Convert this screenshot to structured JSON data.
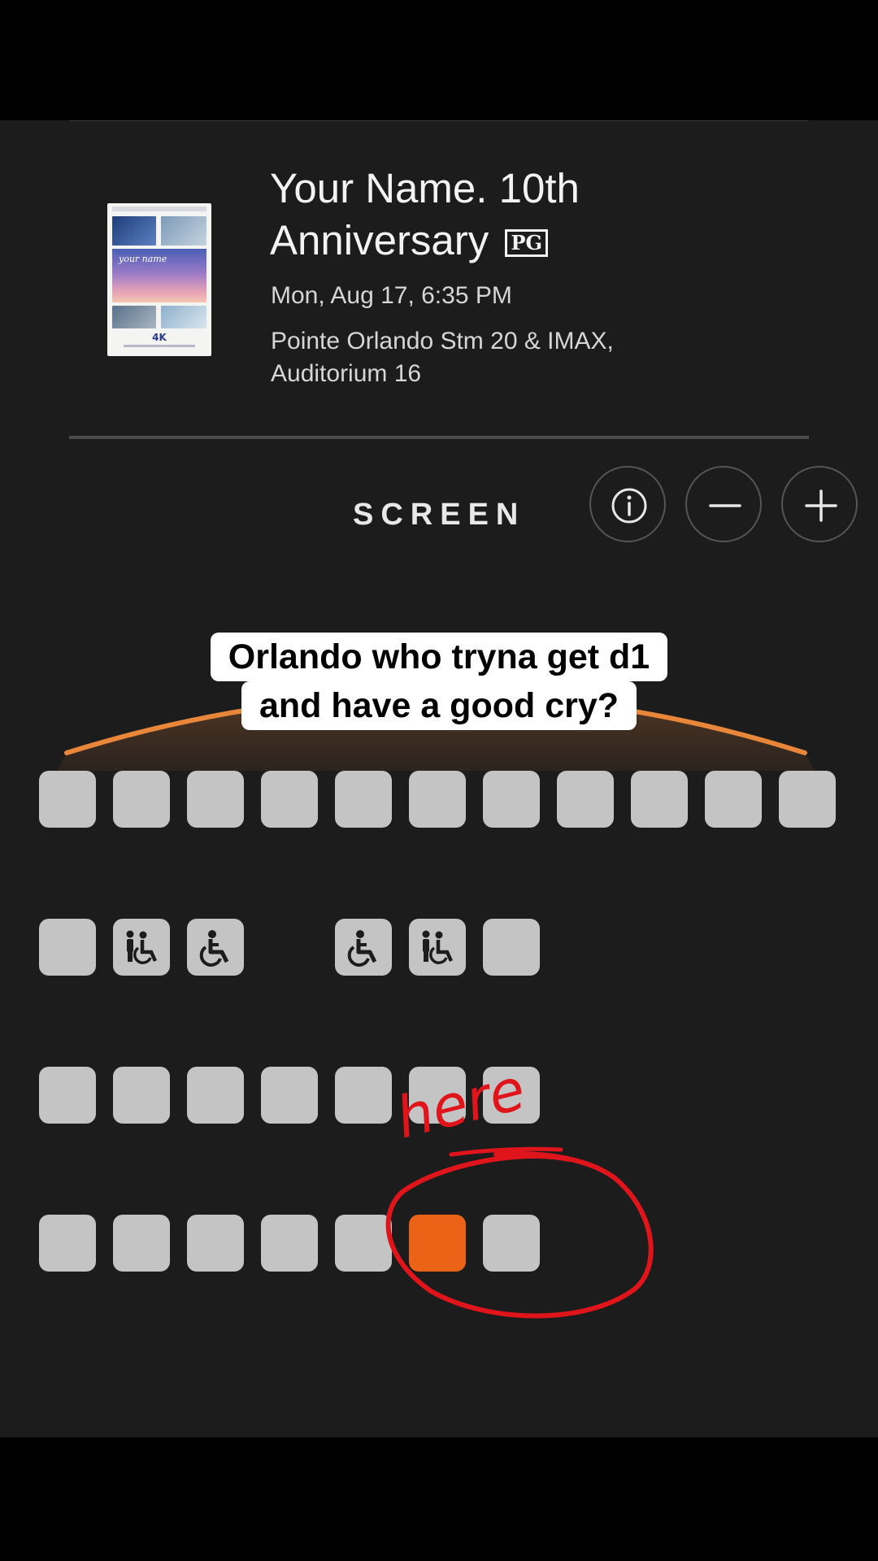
{
  "movie": {
    "title": "Your Name. 10th Anniversary",
    "rating": "PG",
    "showtime": "Mon, Aug 17, 6:35 PM",
    "theater": "Pointe Orlando Stm 20 & IMAX,",
    "auditorium": "Auditorium 16",
    "poster": {
      "logo_text": "your name",
      "format_text": "4K"
    }
  },
  "seatmap": {
    "screen_label": "SCREEN",
    "controls": [
      "info-icon",
      "zoom-out-icon",
      "zoom-in-icon"
    ],
    "accent_color": "#ea6316",
    "screen_color": "#e8863a",
    "rows": [
      {
        "seats": [
          "seat",
          "seat",
          "seat",
          "seat",
          "seat",
          "seat",
          "seat",
          "seat",
          "seat",
          "seat",
          "seat"
        ]
      },
      {
        "seats": [
          "seat",
          "companion",
          "wheelchair",
          "gap",
          "wheelchair",
          "companion",
          "seat"
        ]
      },
      {
        "seats": [
          "seat",
          "seat",
          "seat",
          "seat",
          "seat",
          "seat",
          "seat"
        ]
      },
      {
        "seats": [
          "seat",
          "seat",
          "seat",
          "seat",
          "seat",
          "selected",
          "seat"
        ]
      }
    ]
  },
  "overlay": {
    "caption_line1": "Orlando who tryna get d1",
    "caption_line2": "and have a good cry?",
    "annotation": "here",
    "annotation_color": "#e0141b"
  }
}
